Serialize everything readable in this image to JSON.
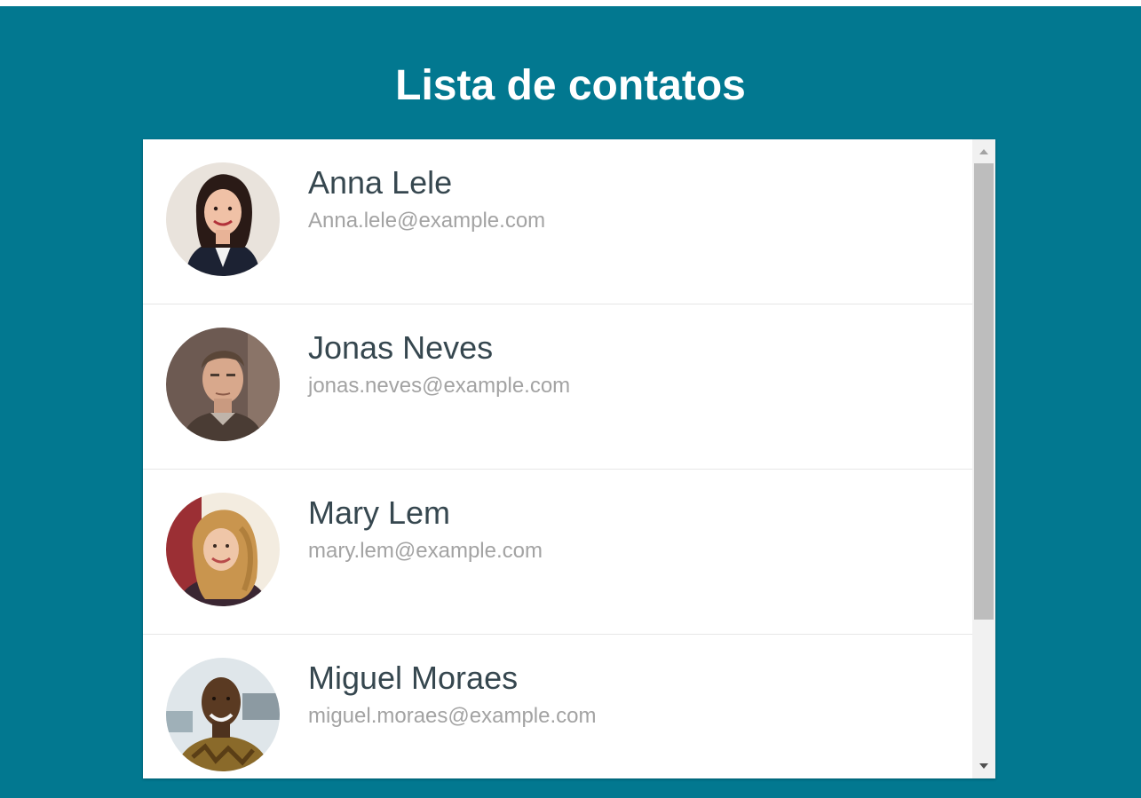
{
  "header": {
    "title": "Lista de contatos"
  },
  "contacts": [
    {
      "name": "Anna Lele",
      "email": "Anna.lele@example.com",
      "avatar_icon": "woman-portrait"
    },
    {
      "name": "Jonas Neves",
      "email": "jonas.neves@example.com",
      "avatar_icon": "man-portrait"
    },
    {
      "name": "Mary Lem",
      "email": "mary.lem@example.com",
      "avatar_icon": "woman-portrait"
    },
    {
      "name": "Miguel Moraes",
      "email": "miguel.moraes@example.com",
      "avatar_icon": "man-portrait"
    }
  ],
  "colors": {
    "background": "#027890",
    "name_text": "#36474f",
    "email_text": "#a3a3a3",
    "panel": "#ffffff"
  },
  "scroll": {
    "position_fraction": 0.0,
    "visible_fraction": 0.74
  }
}
